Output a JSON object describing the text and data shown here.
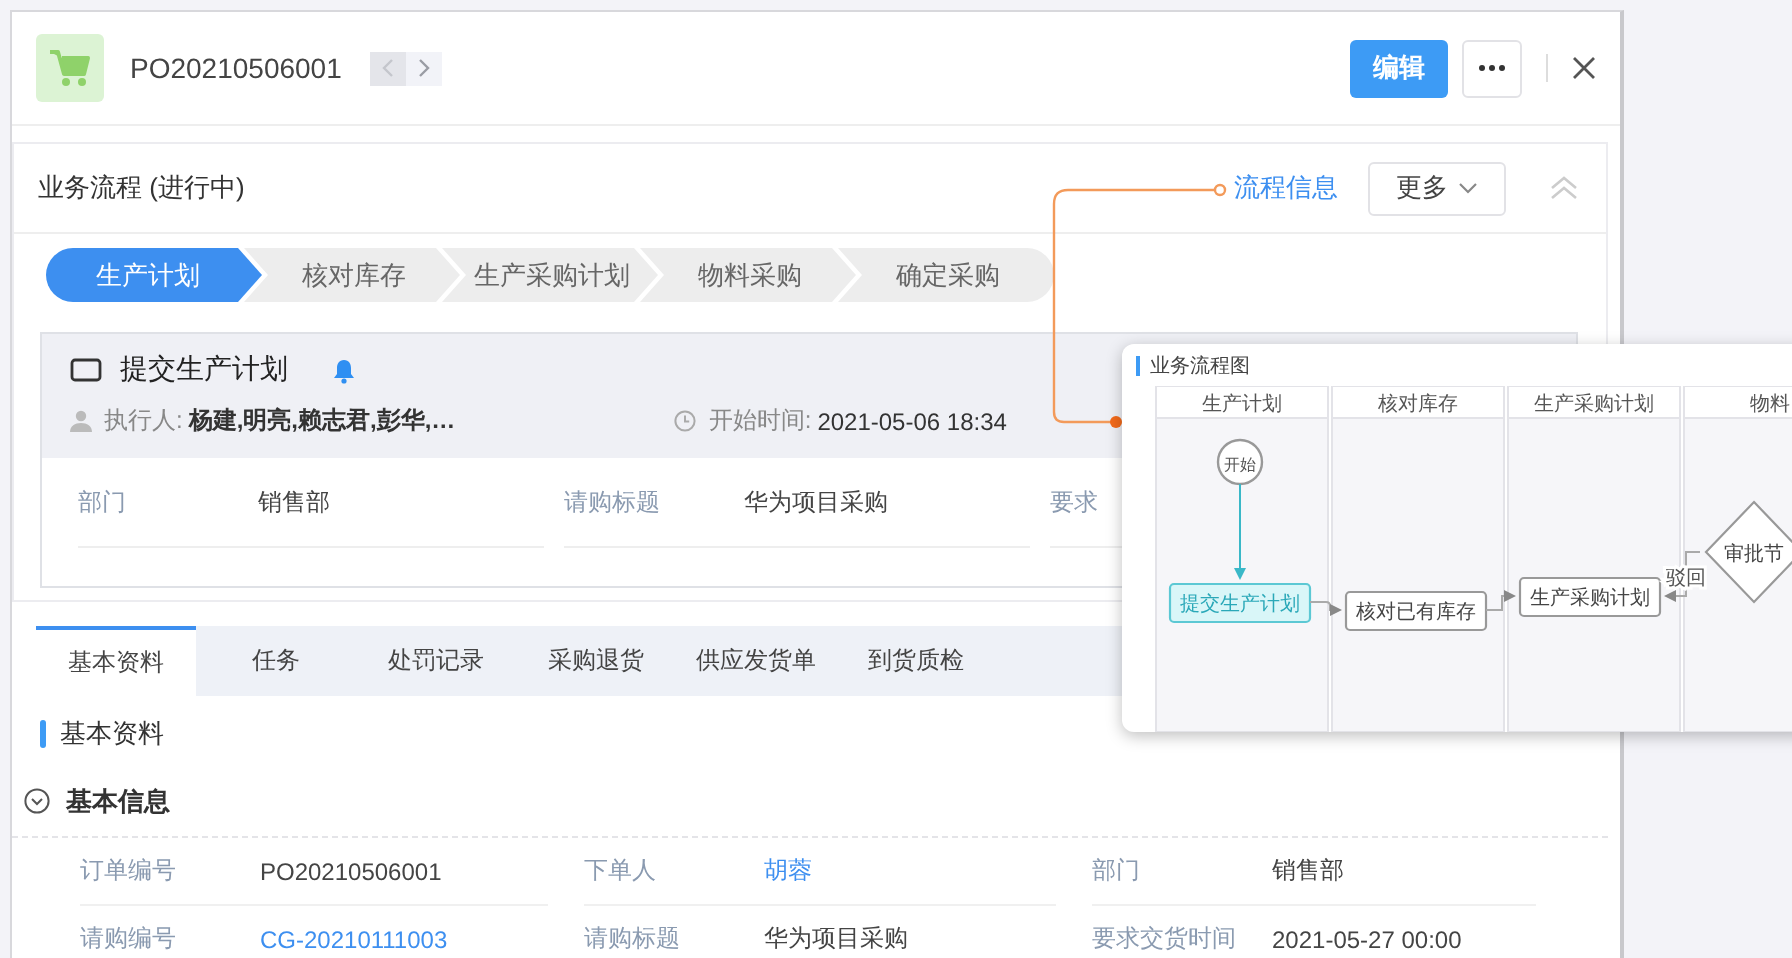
{
  "header": {
    "record_id": "PO20210506001",
    "nav": [
      {
        "disabled": true
      },
      {
        "disabled": false
      }
    ],
    "edit_button": "编辑"
  },
  "process": {
    "title": "业务流程 (进行中)",
    "info_link": "流程信息",
    "more_button": "更多",
    "steps": [
      {
        "label": "生产计划",
        "selected": true
      },
      {
        "label": "核对库存",
        "selected": false
      },
      {
        "label": "生产采购计划",
        "selected": false
      },
      {
        "label": "物料采购",
        "selected": false
      },
      {
        "label": "确定采购",
        "selected": false
      }
    ],
    "task": {
      "title": "提交生产计划",
      "executor_label": "执行人:",
      "executors": "杨建,明亮,赖志君,彭华,…",
      "start_label": "开始时间:",
      "start_time": "2021-05-06 18:34",
      "fields": [
        {
          "label": "部门",
          "value": "销售部"
        },
        {
          "label": "请购标题",
          "value": "华为项目采购"
        },
        {
          "label": "要求"
        }
      ]
    }
  },
  "tabs": [
    {
      "label": "基本资料",
      "selected": true
    },
    {
      "label": "任务",
      "selected": false
    },
    {
      "label": "处罚记录",
      "selected": false
    },
    {
      "label": "采购退货",
      "selected": false
    },
    {
      "label": "供应发货单",
      "selected": false
    },
    {
      "label": "到货质检",
      "selected": false
    }
  ],
  "section_title": "基本资料",
  "group": {
    "title": "基本信息",
    "expanded": true
  },
  "fields": [
    {
      "label": "订单编号",
      "value": "PO20210506001",
      "link": false
    },
    {
      "label": "下单人",
      "value": "胡蓉",
      "link": true
    },
    {
      "label": "部门",
      "value": "销售部",
      "link": false
    },
    {
      "label": "请购编号",
      "value": "CG-20210111003",
      "link": true
    },
    {
      "label": "请购标题",
      "value": "华为项目采购",
      "link": false
    },
    {
      "label": "要求交货时间",
      "value": "2021-05-27 00:00",
      "link": false
    }
  ],
  "flow_popup": {
    "title": "业务流程图",
    "lanes": [
      "生产计划",
      "核对库存",
      "生产采购计划",
      "物料"
    ],
    "nodes": [
      {
        "kind": "start",
        "label": "开始"
      },
      {
        "kind": "task",
        "label": "提交生产计划",
        "selected": true
      },
      {
        "kind": "task",
        "label": "核对已有库存",
        "selected": false
      },
      {
        "kind": "task",
        "label": "生产采购计划",
        "selected": false
      },
      {
        "kind": "decision",
        "label": "审批节"
      }
    ],
    "edge_label": "驳回"
  }
}
